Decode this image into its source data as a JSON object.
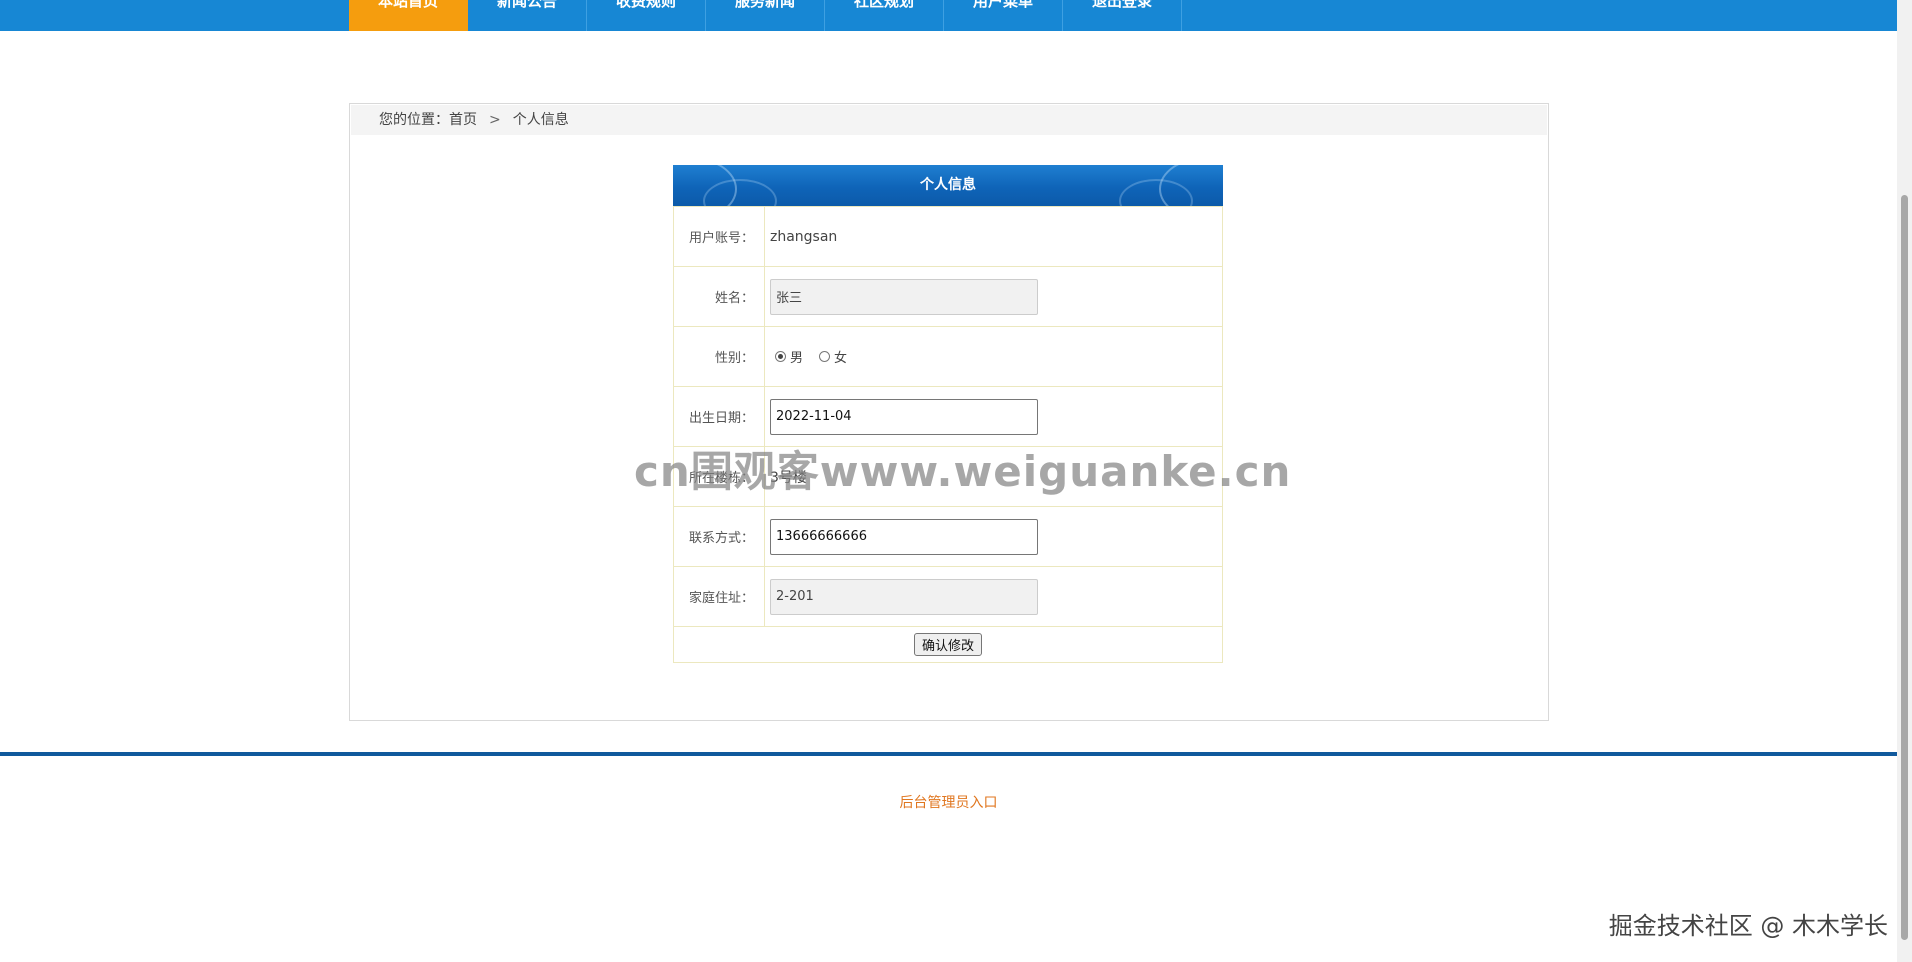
{
  "nav": {
    "items": [
      {
        "label": "本站首页",
        "active": true
      },
      {
        "label": "新闻公告",
        "active": false
      },
      {
        "label": "收费规则",
        "active": false
      },
      {
        "label": "服务新闻",
        "active": false
      },
      {
        "label": "社区规划",
        "active": false
      },
      {
        "label": "用户菜单",
        "active": false
      },
      {
        "label": "退出登录",
        "active": false
      }
    ]
  },
  "breadcrumb": {
    "prefix": "您的位置：",
    "home": "首页",
    "separator": ">",
    "current": "个人信息"
  },
  "form": {
    "title": "个人信息",
    "account": {
      "label": "用户账号：",
      "value": "zhangsan"
    },
    "name": {
      "label": "姓名：",
      "value": "张三"
    },
    "gender": {
      "label": "性别：",
      "male": "男",
      "female": "女",
      "selected": "男"
    },
    "birth": {
      "label": "出生日期：",
      "value": "2022-11-04"
    },
    "building": {
      "label": "所在楼栋：",
      "value": "3号楼"
    },
    "phone": {
      "label": "联系方式：",
      "value": "13666666666"
    },
    "address": {
      "label": "家庭住址：",
      "value": "2-201"
    },
    "submit_label": "确认修改"
  },
  "footer": {
    "admin_link": "后台管理员入口"
  },
  "watermarks": {
    "center": "cn围观客www.weiguanke.cn",
    "corner": "掘金技术社区 @ 木木学长"
  },
  "colors": {
    "nav_bg": "#1787d4",
    "nav_active": "#f59d0e",
    "footer_line": "#10599c",
    "admin_link": "#e0761f"
  }
}
